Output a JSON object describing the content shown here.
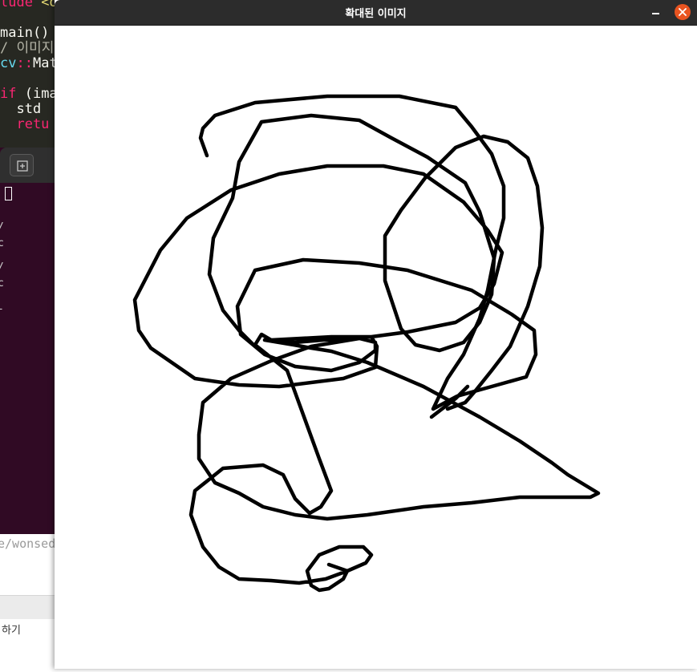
{
  "editor": {
    "lines": [
      {
        "segments": [
          {
            "t": "lude ",
            "c": "tk-kw"
          },
          {
            "t": "<op",
            "c": "tk-yellow"
          }
        ]
      },
      {
        "segments": [
          {
            "t": "",
            "c": "tk-white"
          }
        ]
      },
      {
        "segments": [
          {
            "t": "main() ",
            "c": "tk-white"
          },
          {
            "t": "-",
            "c": "tk-white"
          }
        ]
      },
      {
        "segments": [
          {
            "t": "/ 이미지",
            "c": "tk-comment"
          }
        ]
      },
      {
        "segments": [
          {
            "t": "cv",
            "c": "tk-cyan"
          },
          {
            "t": "::",
            "c": "tk-kw"
          },
          {
            "t": "Mat",
            "c": "tk-ns"
          }
        ]
      },
      {
        "segments": [
          {
            "t": "",
            "c": "tk-white"
          }
        ]
      },
      {
        "segments": [
          {
            "t": "if ",
            "c": "tk-kw"
          },
          {
            "t": "(imag",
            "c": "tk-white"
          }
        ]
      },
      {
        "segments": [
          {
            "t": "  std",
            "c": "tk-ns"
          }
        ]
      },
      {
        "segments": [
          {
            "t": "  retu",
            "c": "tk-kw"
          }
        ]
      }
    ]
  },
  "terminal": {
    "glyphs": [
      "/",
      "c",
      "/",
      "c",
      "-"
    ],
    "path_text": "e/wonsed"
  },
  "status_bar": {
    "label": "하기"
  },
  "window": {
    "title": "확대된 이미지",
    "minimize_icon": "minimize-icon",
    "close_icon": "close-icon",
    "accent_close": "#e95420",
    "titlebar_bg": "#2c2c2c"
  },
  "drawing": {
    "stroke_color": "#000000",
    "background": "#ffffff"
  }
}
